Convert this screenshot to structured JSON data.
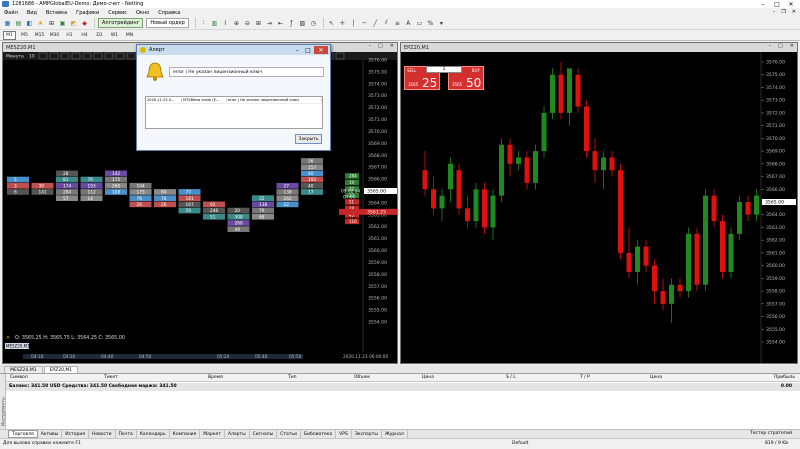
{
  "window": {
    "title": "1281686 - AMPGlobalEU-Demo: Демо-счет - Netting",
    "controls": [
      "–",
      "□",
      "✕"
    ]
  },
  "menu": {
    "items": [
      "Файл",
      "Вид",
      "Вставка",
      "Графики",
      "Сервис",
      "Окно",
      "Справка"
    ],
    "mdi_controls": [
      "–",
      "❐",
      "✕"
    ]
  },
  "toolbar": {
    "algo_label": "Алготрейдинг",
    "new_order_label": "Новый ордер"
  },
  "timeframes": {
    "items": [
      "M1",
      "M5",
      "M15",
      "M30",
      "H1",
      "H4",
      "D1",
      "W1",
      "MN"
    ],
    "active_index": 0
  },
  "chart1": {
    "title": "MESZ20,M1",
    "controls": [
      "–",
      "□",
      "✕"
    ],
    "header_label": "Минута",
    "header_value": "10",
    "ohlc": "O: 3565.25  H: 3565.75  L: 3564.25  C: 3565.00",
    "symbol_marker": "MESZ20,M1",
    "price_ticks": [
      "3576.00",
      "3575.00",
      "3574.00",
      "3573.00",
      "3572.00",
      "3571.00",
      "3570.00",
      "3569.00",
      "3568.00",
      "3567.00",
      "3566.00",
      "3565.00",
      "3564.00",
      "3563.00",
      "3562.00",
      "3561.00",
      "3560.00",
      "3559.00",
      "3558.00",
      "3557.00",
      "3556.00",
      "3555.00",
      "3554.00"
    ],
    "current_price": "3565.00",
    "red_price": "3563.25",
    "time_ticks": [
      "04:10",
      "04:30",
      "04:40",
      "04:50",
      "05:20",
      "05:40",
      "05:50"
    ],
    "date_label": "2020.11.23 06:00:00",
    "clock": "09 02 04",
    "clock2": "07:50",
    "volume_ladder": [
      "284",
      "19",
      "32",
      "27",
      "51",
      "18",
      "45",
      "116"
    ],
    "footprint_columns": [
      [
        "5",
        "3",
        "6"
      ],
      [
        "39",
        "141"
      ],
      [
        "28",
        "81",
        "174",
        "284",
        "57"
      ],
      [
        "76",
        "193",
        "112",
        "14"
      ],
      [
        "142",
        "175",
        "260",
        "108"
      ],
      [
        "104",
        "175",
        "76",
        "26"
      ],
      [
        "60",
        "76",
        "26"
      ],
      [
        "77",
        "181",
        "167",
        "59"
      ],
      [
        "92",
        "246",
        "51"
      ],
      [
        "20",
        "308",
        "268",
        "49"
      ],
      [
        "32",
        "138",
        "79",
        "68"
      ],
      [
        "27",
        "138",
        "262",
        "22"
      ],
      [
        "56",
        "157",
        "40",
        "192",
        "40",
        "17"
      ]
    ]
  },
  "chart2": {
    "title": "EPZ20,M1",
    "controls": [
      "–",
      "□",
      "✕"
    ],
    "price_ticks": [
      "3576.00",
      "3575.00",
      "3574.00",
      "3573.00",
      "3572.00",
      "3571.00",
      "3570.00",
      "3569.00",
      "3568.00",
      "3567.00",
      "3566.00",
      "3565.00",
      "3564.00",
      "3563.00",
      "3562.00",
      "3561.00",
      "3560.00",
      "3559.00",
      "3558.00",
      "3557.00",
      "3556.00",
      "3555.00",
      "3554.00"
    ],
    "current_price": "3565.00",
    "colors": {
      "bull": "#1f8a1f",
      "bear": "#e01010"
    },
    "candles": [
      [
        3567.5,
        3569.0,
        3565.5,
        3566.0
      ],
      [
        3566.0,
        3567.0,
        3564.0,
        3564.5
      ],
      [
        3564.5,
        3566.0,
        3563.5,
        3565.5
      ],
      [
        3566.0,
        3568.5,
        3565.0,
        3568.0
      ],
      [
        3567.5,
        3568.0,
        3564.0,
        3564.5
      ],
      [
        3564.5,
        3565.5,
        3563.0,
        3563.5
      ],
      [
        3563.5,
        3566.5,
        3563.0,
        3566.0
      ],
      [
        3566.0,
        3566.5,
        3562.5,
        3563.0
      ],
      [
        3563.0,
        3566.0,
        3562.0,
        3565.5
      ],
      [
        3565.5,
        3570.0,
        3565.0,
        3569.5
      ],
      [
        3569.5,
        3570.0,
        3567.0,
        3568.0
      ],
      [
        3568.0,
        3569.0,
        3567.5,
        3568.5
      ],
      [
        3568.5,
        3569.0,
        3566.0,
        3566.5
      ],
      [
        3566.5,
        3569.5,
        3566.0,
        3569.0
      ],
      [
        3569.0,
        3572.5,
        3568.5,
        3572.0
      ],
      [
        3572.0,
        3575.5,
        3571.5,
        3575.0
      ],
      [
        3575.0,
        3576.0,
        3571.5,
        3572.0
      ],
      [
        3572.0,
        3575.5,
        3571.0,
        3575.5
      ],
      [
        3575.0,
        3575.5,
        3572.0,
        3572.5
      ],
      [
        3572.5,
        3573.0,
        3568.5,
        3569.0
      ],
      [
        3569.0,
        3570.0,
        3566.5,
        3567.5
      ],
      [
        3567.5,
        3569.0,
        3566.0,
        3568.5
      ],
      [
        3568.5,
        3569.0,
        3567.0,
        3567.5
      ],
      [
        3567.5,
        3568.0,
        3560.5,
        3561.0
      ],
      [
        3561.0,
        3563.0,
        3559.0,
        3559.5
      ],
      [
        3559.5,
        3562.0,
        3558.5,
        3561.5
      ],
      [
        3561.5,
        3562.0,
        3559.5,
        3560.0
      ],
      [
        3560.0,
        3560.5,
        3557.0,
        3558.0
      ],
      [
        3558.0,
        3559.0,
        3556.5,
        3557.0
      ],
      [
        3557.0,
        3559.0,
        3555.5,
        3558.5
      ],
      [
        3558.5,
        3559.0,
        3557.5,
        3558.0
      ],
      [
        3558.0,
        3563.0,
        3557.5,
        3562.5
      ],
      [
        3562.5,
        3563.0,
        3558.0,
        3558.5
      ],
      [
        3558.5,
        3566.0,
        3558.0,
        3565.5
      ],
      [
        3565.5,
        3566.0,
        3563.0,
        3563.5
      ],
      [
        3563.5,
        3564.0,
        3559.0,
        3559.5
      ],
      [
        3559.5,
        3563.0,
        3559.0,
        3562.5
      ],
      [
        3562.5,
        3565.5,
        3562.0,
        3565.0
      ],
      [
        3565.0,
        3565.5,
        3563.5,
        3564.0
      ],
      [
        3564.0,
        3566.0,
        3563.5,
        3565.5
      ]
    ]
  },
  "trade_panel": {
    "sell_label": "SELL",
    "buy_label": "BUY",
    "volume": "1",
    "sell_price": "3565",
    "sell_big": "25",
    "buy_price": "3565",
    "buy_big": "50"
  },
  "alert": {
    "title": "Алерт",
    "controls": [
      "–",
      "□",
      "✕"
    ],
    "message": "error | Не указан лицензионный ключ",
    "row": {
      "time": "2020.11.23 0...",
      "source": "MTSBlesa trade (E...",
      "text": "error | Не указан лицензионный ключ"
    },
    "close_label": "Закрыть"
  },
  "chart_tabs": {
    "items": [
      "MESZ20,M1",
      "EPZ20,M1"
    ],
    "active_index": 1
  },
  "terminal": {
    "columns": [
      "Символ",
      "Тикет",
      "Время",
      "Тип",
      "Объем",
      "Цена",
      "S / L",
      "T / P",
      "Цена",
      "Прибыль"
    ],
    "balance_text": "Баланс: 341.50 USD  Средства: 341.50  Свободная маржа: 341.50",
    "balance_value": "0.00",
    "side_label": "Инструменты",
    "tabs": [
      "Торговля",
      "Активы",
      "История",
      "Новости",
      "Почта",
      "Календарь",
      "Компания",
      "Маркет",
      "Алерты",
      "Сигналы",
      "Статьи",
      "Библиотека",
      "VPS",
      "Эксперты",
      "Журнал"
    ],
    "active_tab": 0,
    "tester_label": "Тестер стратегий"
  },
  "statusbar": {
    "help": "Для вызова справки нажмите F1",
    "profile": "Default",
    "traffic": "819 / 9 Kb"
  }
}
